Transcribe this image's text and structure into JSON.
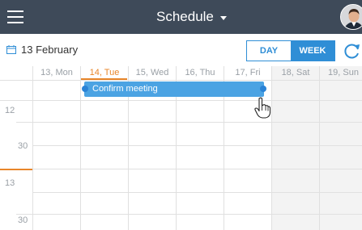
{
  "header": {
    "title": "Schedule",
    "menu_icon": "hamburger-menu-icon",
    "dropdown_icon": "caret-down-icon",
    "avatar_icon": "user-avatar"
  },
  "date_bar": {
    "current_date": "13 February",
    "calendar_icon": "calendar-icon",
    "view_toggle": {
      "day_label": "DAY",
      "week_label": "WEEK",
      "selected": "WEEK"
    },
    "refresh_icon": "refresh-icon"
  },
  "days": [
    {
      "label": "13, Mon",
      "active": false
    },
    {
      "label": "14, Tue",
      "active": true
    },
    {
      "label": "15, Wed",
      "active": false
    },
    {
      "label": "16, Thu",
      "active": false
    },
    {
      "label": "17, Fri",
      "active": false
    },
    {
      "label": "18, Sat",
      "active": false
    },
    {
      "label": "19, Sun",
      "active": false
    }
  ],
  "time_labels": [
    "12",
    "30",
    "13",
    "30"
  ],
  "event": {
    "title": "Confirm meeting",
    "start_day": "14, Tue",
    "end_day": "17, Fri"
  },
  "colors": {
    "header_bg": "#3e4a59",
    "accent_blue": "#2f8ed6",
    "event_blue": "#4ba3e3",
    "today_orange": "#e8862a"
  }
}
